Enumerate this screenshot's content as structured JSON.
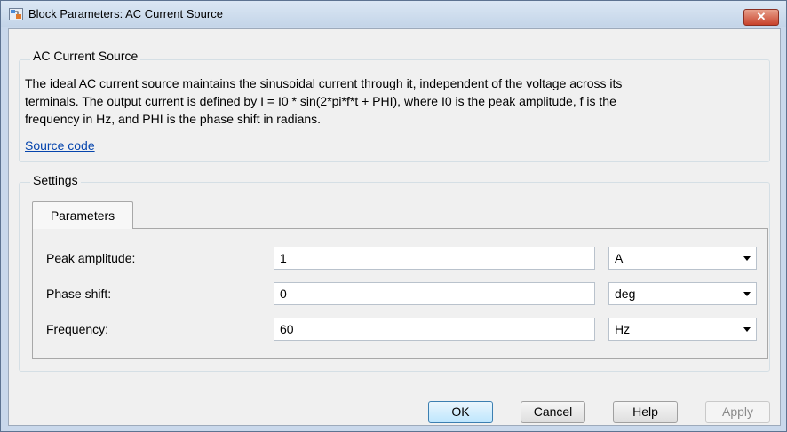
{
  "window": {
    "title": "Block Parameters: AC Current Source",
    "close_label": "✕"
  },
  "block": {
    "group_title": "AC Current Source",
    "description": [
      "The ideal AC current source maintains the sinusoidal current through it, independent of the voltage across its",
      "terminals. The output current is defined by I = I0 * sin(2*pi*f*t + PHI), where I0 is the peak amplitude, f is the",
      "frequency in Hz, and PHI is the phase shift in radians."
    ],
    "source_link": "Source code"
  },
  "settings": {
    "group_title": "Settings",
    "tab_label": "Parameters",
    "params": [
      {
        "label": "Peak amplitude:",
        "value": "1",
        "unit": "A"
      },
      {
        "label": "Phase shift:",
        "value": "0",
        "unit": "deg"
      },
      {
        "label": "Frequency:",
        "value": "60",
        "unit": "Hz"
      }
    ]
  },
  "buttons": {
    "ok": "OK",
    "cancel": "Cancel",
    "help": "Help",
    "apply": "Apply"
  },
  "colors": {
    "link": "#0645ad",
    "close_button": "#c7412a",
    "frame": "#c9d8eb"
  },
  "icons": {
    "app": "simulink-block-icon",
    "dropdown": "chevron-down-icon"
  }
}
